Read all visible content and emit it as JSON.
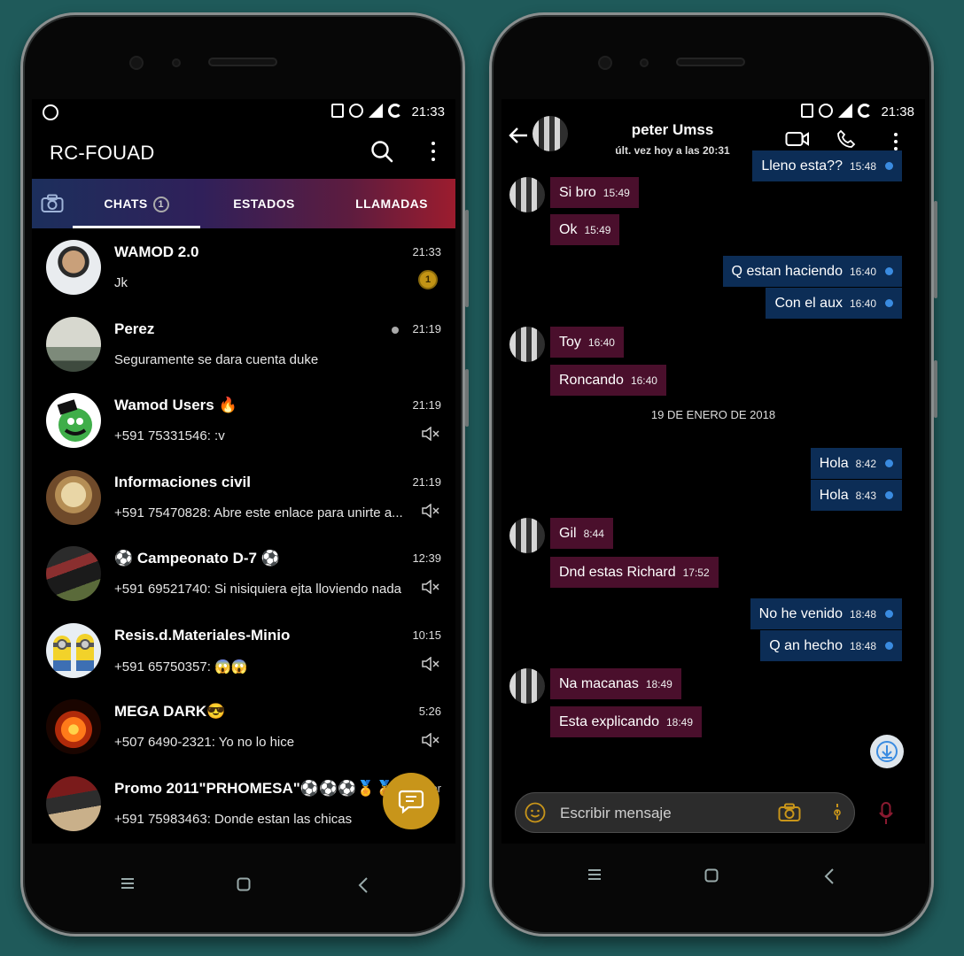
{
  "left": {
    "status_time": "21:33",
    "app_title": "RC-FOUAD",
    "tabs": {
      "chats": "CHATS",
      "chats_badge": "1",
      "estados": "ESTADOS",
      "llamadas": "LLAMADAS"
    },
    "chats": [
      {
        "name": "WAMOD 2.0",
        "time": "21:33",
        "message": "Jk",
        "unread": "1"
      },
      {
        "name": "Perez",
        "time": "21:19",
        "message": "Seguramente se dara cuenta duke"
      },
      {
        "name": "Wamod Users 🔥",
        "time": "21:19",
        "message": "+591 75331546: :v"
      },
      {
        "name": "Informaciones civil",
        "time": "21:19",
        "message": "+591 75470828: Abre este enlace para unirte a..."
      },
      {
        "name": "⚽ Campeonato D-7 ⚽",
        "time": "12:39",
        "message": "+591 69521740: Si nisiquiera ejta lloviendo nada"
      },
      {
        "name": "Resis.d.Materiales-Minio",
        "time": "10:15",
        "message": "+591 65750357: 😱😱"
      },
      {
        "name": "MEGA DARK😎",
        "time": "5:26",
        "message": "+507 6490-2321: Yo no lo hice"
      },
      {
        "name": "Promo 2011\"PRHOMESA\"⚽⚽⚽🏅🏅",
        "time": "er",
        "message": "+591 75983463: Donde estan las chicas"
      }
    ],
    "colors": {
      "tab_start": "#1c2f5c",
      "tab_end": "#9c1c2e",
      "fab": "#c8951a"
    }
  },
  "right": {
    "status_time": "21:38",
    "contact_name": "peter Umss",
    "last_seen": "últ. vez hoy a las 20:31",
    "messages": [
      {
        "dir": "out",
        "text": "Lleno esta??",
        "time": "15:48"
      },
      {
        "dir": "in",
        "text": "Si bro",
        "time": "15:49"
      },
      {
        "dir": "in",
        "text": "Ok",
        "time": "15:49"
      },
      {
        "dir": "out",
        "text": "Q estan haciendo",
        "time": "16:40"
      },
      {
        "dir": "out",
        "text": "Con el aux",
        "time": "16:40"
      },
      {
        "dir": "in",
        "text": "Toy",
        "time": "16:40"
      },
      {
        "dir": "in",
        "text": "Roncando",
        "time": "16:40"
      },
      {
        "dir": "out",
        "text": "Hola",
        "time": "8:42"
      },
      {
        "dir": "out",
        "text": "Hola",
        "time": "8:43"
      },
      {
        "dir": "in",
        "text": "Gil",
        "time": "8:44"
      },
      {
        "dir": "in",
        "text": "Dnd estas Richard",
        "time": "17:52"
      },
      {
        "dir": "out",
        "text": "No he venido",
        "time": "18:48"
      },
      {
        "dir": "out",
        "text": "Q an hecho",
        "time": "18:48"
      },
      {
        "dir": "in",
        "text": "Na macanas",
        "time": "18:49"
      },
      {
        "dir": "in",
        "text": "Esta explicando",
        "time": "18:49"
      }
    ],
    "date_separator": "19 DE ENERO DE 2018",
    "composer_placeholder": "Escribir mensaje",
    "colors": {
      "bubble_out": "#0c2d56",
      "bubble_in": "#4a0f2c",
      "tick": "#3a8be0"
    }
  }
}
